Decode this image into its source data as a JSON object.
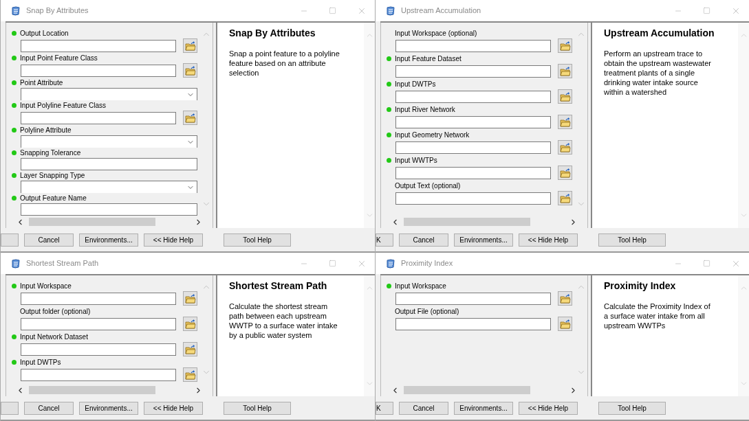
{
  "windows": [
    {
      "title": "Snap By Attributes",
      "params": [
        {
          "label": "Output Location",
          "required": true,
          "kind": "file"
        },
        {
          "label": "Input Point Feature Class",
          "required": true,
          "kind": "file"
        },
        {
          "label": "Point Attribute",
          "required": true,
          "kind": "dropdown"
        },
        {
          "label": "Input Polyline Feature Class",
          "required": true,
          "kind": "file"
        },
        {
          "label": "Polyline Attribute",
          "required": true,
          "kind": "dropdown"
        },
        {
          "label": "Snapping Tolerance",
          "required": true,
          "kind": "text"
        },
        {
          "label": "Layer Snapping Type",
          "required": true,
          "kind": "dropdown"
        },
        {
          "label": "Output Feature Name",
          "required": true,
          "kind": "text"
        }
      ],
      "help": {
        "heading": "Snap By Attributes",
        "text": "Snap a point feature to a polyline feature based on an attribute selection"
      },
      "buttons": [
        {
          "cut": true
        },
        {
          "label": "Cancel"
        },
        {
          "label": "Environments..."
        },
        {
          "label": "<< Hide Help"
        },
        {
          "label": "Tool Help"
        }
      ]
    },
    {
      "title": "Upstream Accumulation",
      "params": [
        {
          "label": "Input Workspace (optional)",
          "required": false,
          "kind": "file"
        },
        {
          "label": "Input Feature Dataset",
          "required": true,
          "kind": "file"
        },
        {
          "label": "Input DWTPs",
          "required": true,
          "kind": "file"
        },
        {
          "label": "Input River Network",
          "required": true,
          "kind": "file"
        },
        {
          "label": "Input Geometry Network",
          "required": true,
          "kind": "file"
        },
        {
          "label": "Input WWTPs",
          "required": true,
          "kind": "file"
        },
        {
          "label": "Output Text (optional)",
          "required": false,
          "kind": "file"
        }
      ],
      "help": {
        "heading": "Upstream Accumulation",
        "text": "Perform an upstream trace to obtain the upstream wastewater treatment plants of a single drinking water intake source within a watershed"
      },
      "buttons": [
        {
          "label": "K",
          "cut": true
        },
        {
          "label": "Cancel"
        },
        {
          "label": "Environments..."
        },
        {
          "label": "<< Hide Help"
        },
        {
          "label": "Tool Help"
        }
      ]
    },
    {
      "title": "Shortest Stream Path",
      "params": [
        {
          "label": "Input Workspace",
          "required": true,
          "kind": "file"
        },
        {
          "label": "Output folder (optional)",
          "required": false,
          "kind": "file"
        },
        {
          "label": "Input Network Dataset",
          "required": true,
          "kind": "file"
        },
        {
          "label": "Input DWTPs",
          "required": true,
          "kind": "file"
        }
      ],
      "help": {
        "heading": "Shortest Stream Path",
        "text": "Calculate the shortest stream path between each upstream WWTP to a surface water intake by a public water system"
      },
      "buttons": [
        {
          "cut": true
        },
        {
          "label": "Cancel"
        },
        {
          "label": "Environments..."
        },
        {
          "label": "<< Hide Help"
        },
        {
          "label": "Tool Help"
        }
      ]
    },
    {
      "title": "Proximity Index",
      "params": [
        {
          "label": "Input Workspace",
          "required": true,
          "kind": "file"
        },
        {
          "label": "Output File (optional)",
          "required": false,
          "kind": "file"
        }
      ],
      "help": {
        "heading": "Proximity Index",
        "text": "Calculate the Proximity Index of a surface water intake from all upstream WWTPs"
      },
      "buttons": [
        {
          "label": "K",
          "cut": true
        },
        {
          "label": "Cancel"
        },
        {
          "label": "Environments..."
        },
        {
          "label": "<< Hide Help"
        },
        {
          "label": "Tool Help"
        }
      ]
    }
  ]
}
